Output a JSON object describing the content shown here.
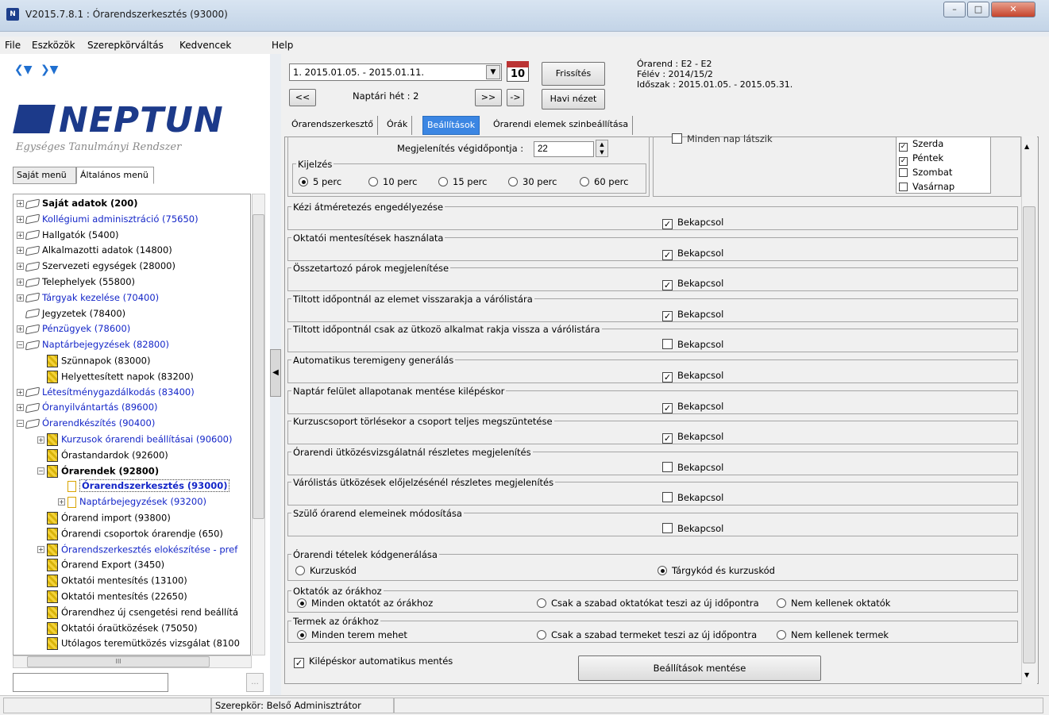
{
  "window": {
    "title": "V2015.7.8.1 : Órarendszerkesztés (93000)",
    "app_icon": "neptun-app-icon",
    "controls": [
      "minimize",
      "maximize",
      "close"
    ]
  },
  "menubar": {
    "items": [
      "File",
      "Eszközök",
      "Szerepkörváltás",
      "Kedvencek",
      "Help"
    ]
  },
  "left": {
    "logo_text": "NEPTUN",
    "tagline": "Egységes Tanulmányi Rendszer",
    "tabs": [
      "Saját menü",
      "Általános menü"
    ],
    "active_tab": "Általános menü",
    "tree": [
      {
        "label": "Saját adatok (200)",
        "level": 0,
        "exp": "+",
        "icon": "folder",
        "style": "bold"
      },
      {
        "label": "Kollégiumi adminisztráció (75650)",
        "level": 0,
        "exp": "+",
        "icon": "folder",
        "style": "blue"
      },
      {
        "label": "Hallgatók (5400)",
        "level": 0,
        "exp": "+",
        "icon": "folder",
        "style": ""
      },
      {
        "label": "Alkalmazotti adatok (14800)",
        "level": 0,
        "exp": "+",
        "icon": "folder",
        "style": ""
      },
      {
        "label": "Szervezeti egységek (28000)",
        "level": 0,
        "exp": "+",
        "icon": "folder",
        "style": ""
      },
      {
        "label": "Telephelyek (55800)",
        "level": 0,
        "exp": "+",
        "icon": "folder",
        "style": ""
      },
      {
        "label": "Tárgyak kezelése (70400)",
        "level": 0,
        "exp": "+",
        "icon": "folder",
        "style": "blue"
      },
      {
        "label": "Jegyzetek (78400)",
        "level": 0,
        "exp": "",
        "icon": "folder",
        "style": ""
      },
      {
        "label": "Pénzügyek (78600)",
        "level": 0,
        "exp": "+",
        "icon": "folder",
        "style": "blue"
      },
      {
        "label": "Naptárbejegyzések (82800)",
        "level": 0,
        "exp": "-",
        "icon": "folder",
        "style": "blue"
      },
      {
        "label": "Szünnapok (83000)",
        "level": 1,
        "exp": "",
        "icon": "doc",
        "style": ""
      },
      {
        "label": "Helyettesített napok (83200)",
        "level": 1,
        "exp": "",
        "icon": "doc",
        "style": ""
      },
      {
        "label": "Létesítménygazdálkodás (83400)",
        "level": 0,
        "exp": "+",
        "icon": "folder",
        "style": "blue"
      },
      {
        "label": "Óranyilvántartás (89600)",
        "level": 0,
        "exp": "+",
        "icon": "folder",
        "style": "blue"
      },
      {
        "label": "Órarendkészítés (90400)",
        "level": 0,
        "exp": "-",
        "icon": "folder",
        "style": "blue"
      },
      {
        "label": "Kurzusok órarendi beállításai (90600)",
        "level": 1,
        "exp": "+",
        "icon": "doc",
        "style": "blue"
      },
      {
        "label": "Órastandardok (92600)",
        "level": 1,
        "exp": "",
        "icon": "doc",
        "style": ""
      },
      {
        "label": "Órarendek (92800)",
        "level": 1,
        "exp": "-",
        "icon": "doc",
        "style": "bold"
      },
      {
        "label": "Órarendszerkesztés (93000)",
        "level": 2,
        "exp": "",
        "icon": "page",
        "style": "selected"
      },
      {
        "label": "Naptárbejegyzések (93200)",
        "level": 2,
        "exp": "+",
        "icon": "page",
        "style": "blue"
      },
      {
        "label": "Órarend import (93800)",
        "level": 1,
        "exp": "",
        "icon": "doc",
        "style": ""
      },
      {
        "label": "Órarendi csoportok órarendje (650)",
        "level": 1,
        "exp": "",
        "icon": "doc",
        "style": ""
      },
      {
        "label": "Órarendszerkesztés elokészítése - pref",
        "level": 1,
        "exp": "+",
        "icon": "doc",
        "style": "blue"
      },
      {
        "label": "Órarend Export (3450)",
        "level": 1,
        "exp": "",
        "icon": "doc",
        "style": ""
      },
      {
        "label": "Oktatói mentesítés (13100)",
        "level": 1,
        "exp": "",
        "icon": "doc",
        "style": ""
      },
      {
        "label": "Oktatói mentesítés (22650)",
        "level": 1,
        "exp": "",
        "icon": "doc",
        "style": ""
      },
      {
        "label": "Órarendhez új csengetési rend beállítá",
        "level": 1,
        "exp": "",
        "icon": "doc",
        "style": ""
      },
      {
        "label": "Oktatói óraütközések (75050)",
        "level": 1,
        "exp": "",
        "icon": "doc",
        "style": ""
      },
      {
        "label": "Utólagos teremütközés vizsgálat (8100",
        "level": 1,
        "exp": "",
        "icon": "doc",
        "style": ""
      }
    ],
    "hscroll_label": "III",
    "search_value": "",
    "search_button": "..."
  },
  "header": {
    "week_select_value": "1. 2015.01.05. - 2015.01.11.",
    "calendar_icon_day": "10",
    "refresh_button": "Frissítés",
    "prev_button": "<<",
    "week_label": "Naptári hét : 2",
    "next_button": ">>",
    "jump_button": "->",
    "month_view_button": "Havi nézet",
    "info_lines": [
      "Órarend : E2 - E2",
      "Félév : 2014/15/2",
      "Időszak : 2015.01.05. - 2015.05.31."
    ]
  },
  "tabs": [
    "Órarendszerkesztő",
    "Órák",
    "Beállítások",
    "Órarendi elemek szinbeállítása"
  ],
  "active_tab": "Beállítások",
  "settings": {
    "end_time_label": "Megjelenítés végidőpontja :",
    "end_time_value": "22",
    "display_group_title": "Kijelzés",
    "display_options": [
      "5 perc",
      "10 perc",
      "15 perc",
      "30 perc",
      "60 perc"
    ],
    "display_selected": "5 perc",
    "every_day_label": "Minden nap látszik",
    "days": [
      {
        "label": "Szerda",
        "checked": true
      },
      {
        "label": "Péntek",
        "checked": true
      },
      {
        "label": "Szombat",
        "checked": false
      },
      {
        "label": "Vasárnap",
        "checked": false
      }
    ],
    "toggle_label": "Bekapcsol",
    "toggles": [
      {
        "title": "Kézi átméretezés engedélyezése",
        "checked": true
      },
      {
        "title": "Oktatói mentesítések használata",
        "checked": true
      },
      {
        "title": "Összetartozó párok megjelenítése",
        "checked": true
      },
      {
        "title": "Tiltott időpontnál az elemet visszarakja a várólistára",
        "checked": true
      },
      {
        "title": "Tiltott időpontnál csak az ütkozö alkalmat rakja vissza a várólistára",
        "checked": false
      },
      {
        "title": "Automatikus teremigeny generálás",
        "checked": true
      },
      {
        "title": "Naptár felület allapotanak mentése kilépéskor",
        "checked": true
      },
      {
        "title": "Kurzuscsoport törlésekor a csoport teljes megszüntetése",
        "checked": true
      },
      {
        "title": "Órarendi ütközésvizsgálatnál részletes megjelenítés",
        "checked": false
      },
      {
        "title": "Várólistás ütközések előjelzésénél részletes megjelenítés",
        "checked": false
      },
      {
        "title": "Szülő órarend elemeinek módosítása",
        "checked": false
      }
    ],
    "code_group_title": "Órarendi tételek kódgenerálása",
    "code_options": [
      "Kurzuskód",
      "Tárgykód és kurzuskód"
    ],
    "code_selected": "Tárgykód és kurzuskód",
    "teachers_group_title": "Oktatók az órákhoz",
    "teachers_options": [
      "Minden oktatót az órákhoz",
      "Csak a szabad oktatókat teszi az új időpontra",
      "Nem kellenek oktatók"
    ],
    "teachers_selected": "Minden oktatót az órákhoz",
    "rooms_group_title": "Termek az órákhoz",
    "rooms_options": [
      "Minden terem mehet",
      "Csak a szabad termeket teszi az új időpontra",
      "Nem kellenek termek"
    ],
    "rooms_selected": "Minden terem mehet",
    "autosave_label": "Kilépéskor automatikus mentés",
    "autosave_checked": true,
    "save_button": "Beállítások mentése"
  },
  "statusbar": {
    "role": "Szerepkör: Belső Adminisztrátor"
  }
}
